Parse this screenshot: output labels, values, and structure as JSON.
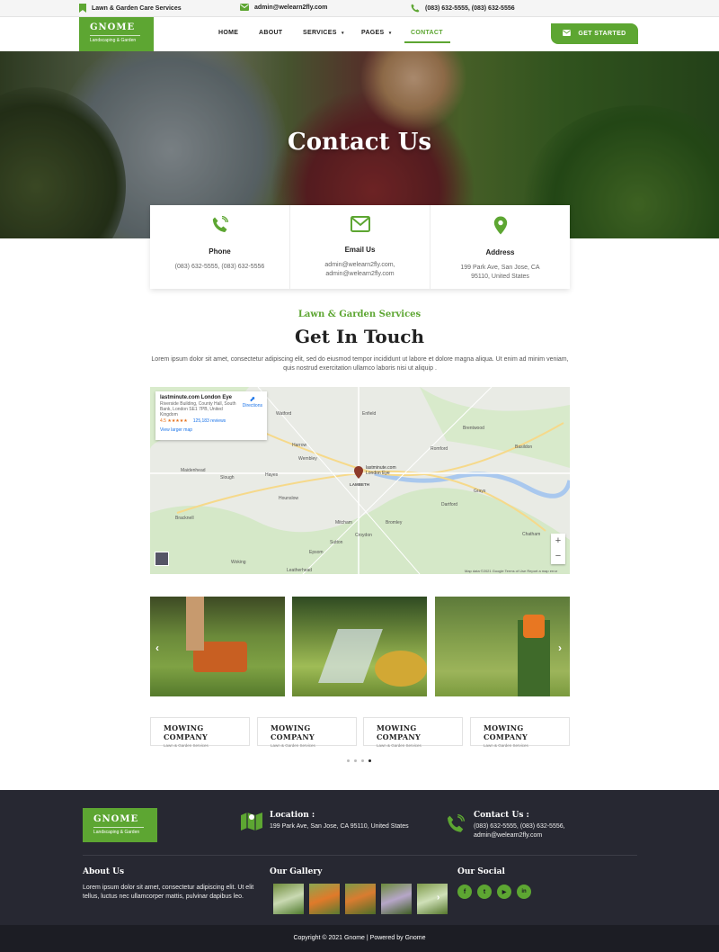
{
  "topbar": {
    "tagline": "Lawn & Garden Care Services",
    "email": "admin@welearn2fly.com",
    "phone": "(083) 632-5555, (083) 632-5556"
  },
  "brand": {
    "name": "GNOME",
    "tagline": "Landscaping & Garden"
  },
  "nav": {
    "items": [
      "HOME",
      "ABOUT",
      "SERVICES",
      "PAGES",
      "CONTACT"
    ],
    "active": "CONTACT",
    "cta": "GET STARTED"
  },
  "hero": {
    "title": "Contact Us"
  },
  "contact_cards": [
    {
      "icon": "phone-icon",
      "title": "Phone",
      "value": "(083) 632-5555, (083) 632-5556"
    },
    {
      "icon": "email-icon",
      "title": "Email Us",
      "value": "admin@welearn2fly.com, admin@welearn2fly.com"
    },
    {
      "icon": "location-icon",
      "title": "Address",
      "value": "199 Park Ave, San Jose, CA 95110, United States"
    }
  ],
  "touch": {
    "subtitle": "Lawn & Garden Services",
    "title": "Get In Touch",
    "text": "Lorem ipsum dolor sit amet, consectetur adipiscing elit, sed do eiusmod tempor incididunt ut labore et dolore magna aliqua. Ut enim ad minim veniam, quis nostrud exercitation ullamco laboris nisi ut aliquip ."
  },
  "map": {
    "place_name": "lastminute.com London Eye",
    "place_address": "Riverside Building, County Hall, South Bank, London SE1 7PB, United Kingdom",
    "rating": "4.5 ★★★★★",
    "reviews": "125,183 reviews",
    "directions": "Directions",
    "view_larger": "View larger map",
    "pin_label": "lastminute.com London Eye",
    "labels": [
      "Watford",
      "Enfield",
      "Harrow",
      "Wembley",
      "Romford",
      "Brentwood",
      "Maidenhead",
      "Slough",
      "Hayes",
      "Hounslow",
      "Bracknell",
      "Woking",
      "Sutton",
      "Croydon",
      "Bromley",
      "Dartford",
      "Grays",
      "Basildon",
      "Chatham",
      "Epsom",
      "Leatherhead",
      "Mitcham",
      "LAMBETH"
    ],
    "footer": "Map data ©2021 Google   Terms of Use   Report a map error",
    "zoom_in": "+",
    "zoom_out": "−"
  },
  "services": [
    {
      "name": "MOWING COMPANY",
      "sub": "Lawn & Garden Services"
    },
    {
      "name": "MOWING COMPANY",
      "sub": "Lawn & Garden Services"
    },
    {
      "name": "MOWING COMPANY",
      "sub": "Lawn & Garden Services"
    },
    {
      "name": "MOWING COMPANY",
      "sub": "Lawn & Garden Services"
    }
  ],
  "footer": {
    "location_title": "Location :",
    "location_text": "199 Park Ave, San Jose, CA 95110, United States",
    "contact_title": "Contact Us :",
    "contact_text": "(083) 632-5555, (083) 632-5556, admin@welearn2fly.com",
    "about_title": "About Us",
    "about_text": "Lorem ipsum dolor sit amet, consectetur adipiscing elit. Ut elit tellus, luctus nec ullamcorper mattis, pulvinar dapibus leo.",
    "gallery_title": "Our Gallery",
    "social_title": "Our Social",
    "social_icons": [
      "f",
      "t",
      "▶",
      "in"
    ],
    "copyright": "Copyright © 2021 Gnome | Powered by Gnome"
  },
  "colors": {
    "accent": "#5da632",
    "footer_bg": "#272832",
    "copyright_bg": "#1c1d24"
  }
}
